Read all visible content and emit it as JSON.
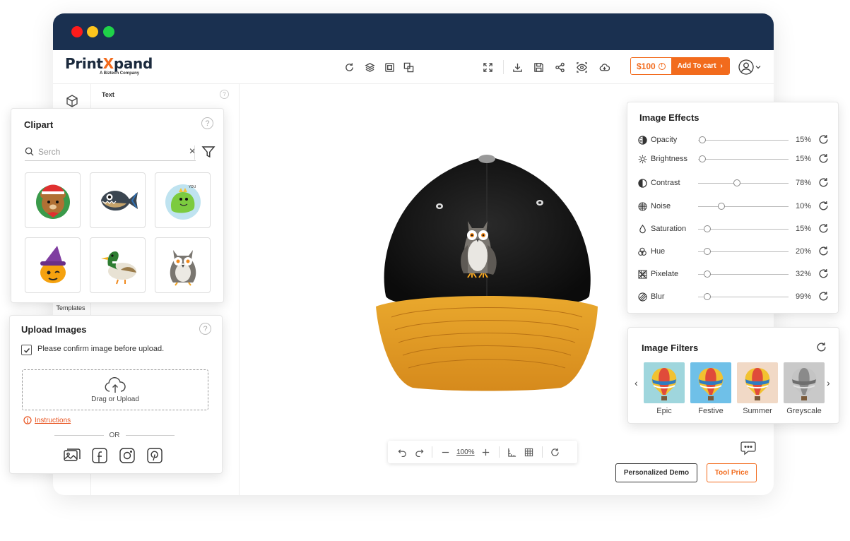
{
  "brand": {
    "name_main": "Print",
    "name_accent": "X",
    "name_tail": "pand",
    "tagline": "A Biztech Company",
    "accent_color": "#f26b1d",
    "navy": "#1a3050"
  },
  "toolbar": {
    "price": "$100",
    "add_to_cart": "Add To cart",
    "icons": [
      "refresh-icon",
      "layers-icon",
      "copy-icon",
      "duplicate-icon",
      "fullscreen-icon",
      "download-icon",
      "save-icon",
      "share-icon",
      "preview-icon",
      "cloud-icon",
      "user-icon"
    ]
  },
  "side_panel": {
    "title": "Text",
    "templates_label": "Templates"
  },
  "clipart": {
    "title": "Clipart",
    "search_placeholder": "Serch",
    "items": [
      "bear-sticker",
      "piranha-fish",
      "dinosaur-sticker",
      "pumpkin-witch",
      "mallard-duck",
      "owl"
    ]
  },
  "upload": {
    "title": "Upload Images",
    "confirm_label": "Please confirm image before upload.",
    "confirm_checked": true,
    "dropzone_label": "Drag or Upload",
    "instructions": "Instructions",
    "or": "OR",
    "sources": [
      "gallery-icon",
      "facebook-icon",
      "instagram-icon",
      "pinterest-icon"
    ]
  },
  "effects": {
    "title": "Image Effects",
    "items": [
      {
        "label": "Opacity",
        "value": "15%",
        "level": 0.05,
        "icon": "opacity-icon"
      },
      {
        "label": "Brightness",
        "value": "15%",
        "level": 0.05,
        "icon": "brightness-icon"
      },
      {
        "label": "Contrast",
        "value": "78%",
        "level": 0.43,
        "icon": "contrast-icon"
      },
      {
        "label": "Noise",
        "value": "10%",
        "level": 0.26,
        "icon": "noise-icon"
      },
      {
        "label": "Saturation",
        "value": "15%",
        "level": 0.1,
        "icon": "saturation-icon"
      },
      {
        "label": "Hue",
        "value": "20%",
        "level": 0.1,
        "icon": "hue-icon"
      },
      {
        "label": "Pixelate",
        "value": "32%",
        "level": 0.1,
        "icon": "pixelate-icon"
      },
      {
        "label": "Blur",
        "value": "99%",
        "level": 0.1,
        "icon": "blur-icon"
      }
    ]
  },
  "filters": {
    "title": "Image Filters",
    "items": [
      {
        "label": "Epic",
        "sky": "#9fd6dd"
      },
      {
        "label": "Festive",
        "sky": "#6fc0e8"
      },
      {
        "label": "Summer",
        "sky": "#f1d9c6"
      },
      {
        "label": "Greyscale",
        "sky": "#c9c9c9"
      }
    ]
  },
  "zoom": {
    "value": "100%"
  },
  "footer": {
    "demo_label": "Personalized Demo",
    "tool_price_label": "Tool Price"
  }
}
